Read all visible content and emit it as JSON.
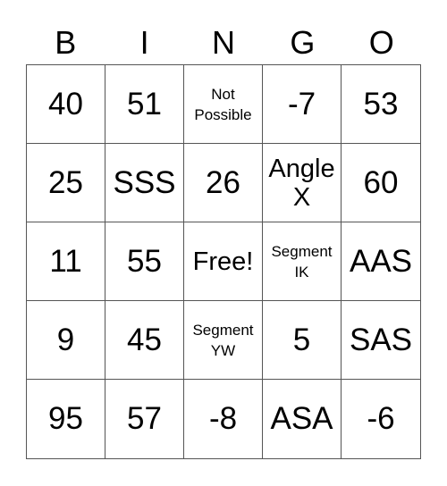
{
  "header": {
    "letters": [
      "B",
      "I",
      "N",
      "G",
      "O"
    ]
  },
  "board": {
    "rows": [
      [
        {
          "text": "40",
          "size": "xl"
        },
        {
          "text": "51",
          "size": "xl"
        },
        {
          "text": "Not\nPossible",
          "size": "sm"
        },
        {
          "text": "-7",
          "size": "xl"
        },
        {
          "text": "53",
          "size": "xl"
        }
      ],
      [
        {
          "text": "25",
          "size": "xl"
        },
        {
          "text": "SSS",
          "size": "xl"
        },
        {
          "text": "26",
          "size": "xl"
        },
        {
          "text": "Angle\nX",
          "size": "lg"
        },
        {
          "text": "60",
          "size": "xl"
        }
      ],
      [
        {
          "text": "11",
          "size": "xl"
        },
        {
          "text": "55",
          "size": "xl"
        },
        {
          "text": "Free!",
          "size": "lg"
        },
        {
          "text": "Segment\nIK",
          "size": "sm"
        },
        {
          "text": "AAS",
          "size": "xl"
        }
      ],
      [
        {
          "text": "9",
          "size": "xl"
        },
        {
          "text": "45",
          "size": "xl"
        },
        {
          "text": "Segment\nYW",
          "size": "sm"
        },
        {
          "text": "5",
          "size": "xl"
        },
        {
          "text": "SAS",
          "size": "xl"
        }
      ],
      [
        {
          "text": "95",
          "size": "xl"
        },
        {
          "text": "57",
          "size": "xl"
        },
        {
          "text": "-8",
          "size": "xl"
        },
        {
          "text": "ASA",
          "size": "xl"
        },
        {
          "text": "-6",
          "size": "xl"
        }
      ]
    ]
  }
}
